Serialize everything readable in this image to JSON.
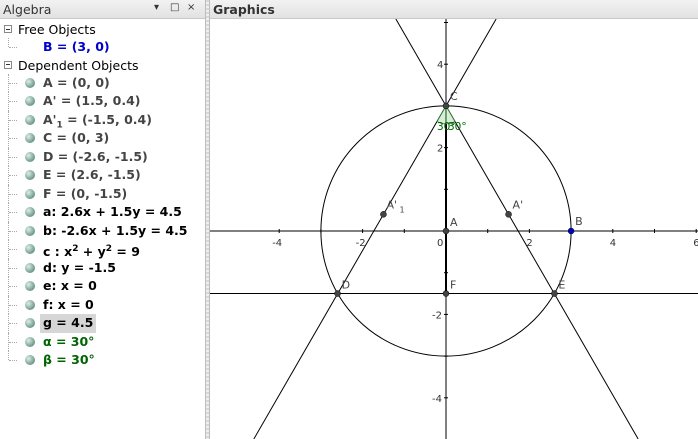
{
  "algebra": {
    "title": "Algebra",
    "buttons": {
      "menu": "▾",
      "restore": "□",
      "close": "×"
    },
    "free_group": "Free Objects",
    "free_items": [
      {
        "name": "point-B",
        "text": "B = (3, 0)"
      }
    ],
    "dependent_group": "Dependent Objects",
    "dependent_items": [
      {
        "name": "point-A",
        "text": "A = (0, 0)",
        "style": "dep"
      },
      {
        "name": "point-A-prime",
        "text": "A' = (1.5, 0.4)",
        "style": "dep"
      },
      {
        "name": "point-A-prime-1",
        "text": "A'",
        "sub": "1",
        "rest": " = (-1.5, 0.4)",
        "style": "dep"
      },
      {
        "name": "point-C",
        "text": "C = (0, 3)",
        "style": "dep"
      },
      {
        "name": "point-D",
        "text": "D = (-2.6, -1.5)",
        "style": "dep"
      },
      {
        "name": "point-E",
        "text": "E = (2.6, -1.5)",
        "style": "dep"
      },
      {
        "name": "point-F",
        "text": "F = (0, -1.5)",
        "style": "dep"
      },
      {
        "name": "line-a",
        "text": "a: 2.6x + 1.5y = 4.5",
        "style": "bold-black"
      },
      {
        "name": "line-b",
        "text": "b: -2.6x + 1.5y = 4.5",
        "style": "bold-black"
      },
      {
        "name": "circle-c",
        "text": "c : x",
        "sup": "2",
        "mid": " + y",
        "sup2": "2",
        "rest": " = 9",
        "style": "bold-black"
      },
      {
        "name": "line-d",
        "text": "d: y = -1.5",
        "style": "bold-black"
      },
      {
        "name": "line-e",
        "text": "e: x = 0",
        "style": "bold-black"
      },
      {
        "name": "line-f",
        "text": "f: x = 0",
        "style": "bold-black"
      },
      {
        "name": "segment-g",
        "text": "g = 4.5",
        "style": "bold-black",
        "selected": true
      },
      {
        "name": "angle-alpha",
        "text": "α = 30°",
        "style": "green"
      },
      {
        "name": "angle-beta",
        "text": "β = 30°",
        "style": "green"
      }
    ]
  },
  "graphics": {
    "title": "Graphics",
    "x_ticks": [
      "-4",
      "-2",
      "0",
      "2",
      "4",
      "6"
    ],
    "y_ticks": [
      "4",
      "2",
      "-2",
      "-4"
    ],
    "point_labels": {
      "A": "A",
      "B": "B",
      "C": "C",
      "D": "D",
      "E": "E",
      "F": "F",
      "Ap": "A'",
      "Ap1": "A'",
      "Ap1_sub": "1"
    },
    "angle_labels": {
      "alpha": "30°",
      "beta": "30°"
    },
    "colors": {
      "free_point": "#0000cc",
      "dep_point": "#444444",
      "angle_fill": "#cfe8cf",
      "angle_text": "#006400"
    }
  }
}
